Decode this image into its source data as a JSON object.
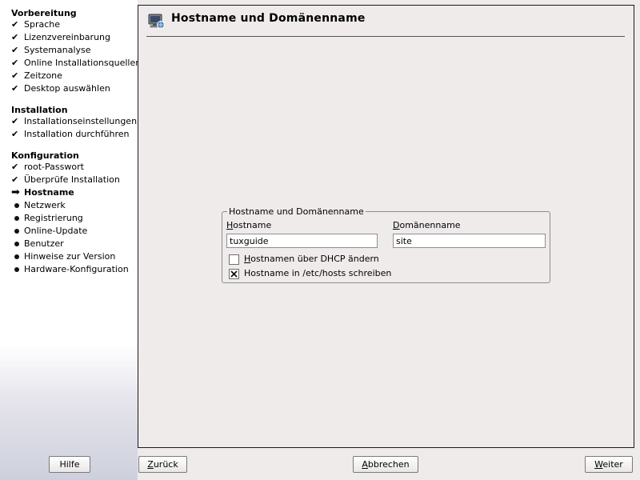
{
  "sidebar": {
    "sections": [
      {
        "title": "Vorbereitung",
        "steps": [
          {
            "label": "Sprache",
            "status": "done"
          },
          {
            "label": "Lizenzvereinbarung",
            "status": "done"
          },
          {
            "label": "Systemanalyse",
            "status": "done"
          },
          {
            "label": "Online Installationsquellen",
            "status": "done"
          },
          {
            "label": "Zeitzone",
            "status": "done"
          },
          {
            "label": "Desktop auswählen",
            "status": "done"
          }
        ]
      },
      {
        "title": "Installation",
        "steps": [
          {
            "label": "Installationseinstellungen",
            "status": "done"
          },
          {
            "label": "Installation durchführen",
            "status": "done"
          }
        ]
      },
      {
        "title": "Konfiguration",
        "steps": [
          {
            "label": "root-Passwort",
            "status": "done"
          },
          {
            "label": "Überprüfe Installation",
            "status": "done"
          },
          {
            "label": "Hostname",
            "status": "current"
          },
          {
            "label": "Netzwerk",
            "status": "pending"
          },
          {
            "label": "Registrierung",
            "status": "pending"
          },
          {
            "label": "Online-Update",
            "status": "pending"
          },
          {
            "label": "Benutzer",
            "status": "pending"
          },
          {
            "label": "Hinweise zur Version",
            "status": "pending"
          },
          {
            "label": "Hardware-Konfiguration",
            "status": "pending"
          }
        ]
      }
    ],
    "icons": {
      "done": "check-icon",
      "current": "arrow-right-icon",
      "pending": "bullet-icon"
    }
  },
  "main": {
    "title": "Hostname und Domänenname",
    "title_icon": "network-computer-icon",
    "group": {
      "legend": "Hostname und Domänenname",
      "hostname_label_mnemonic": "H",
      "hostname_label_rest": "ostname",
      "hostname_value": "tuxguide",
      "domain_label_mnemonic": "D",
      "domain_label_rest": "omänenname",
      "domain_value": "site",
      "dhcp_checkbox": {
        "mnemonic": "H",
        "label_rest": "ostnamen über DHCP ändern",
        "checked": false
      },
      "hosts_checkbox": {
        "label": "Hostname in /etc/hosts schreiben",
        "checked": true
      }
    }
  },
  "buttons": {
    "help": "Hilfe",
    "back_mnemonic": "Z",
    "back_rest": "urück",
    "abort_mnemonic": "A",
    "abort_rest": "bbrechen",
    "next_mnemonic": "W",
    "next_rest": "eiter"
  }
}
